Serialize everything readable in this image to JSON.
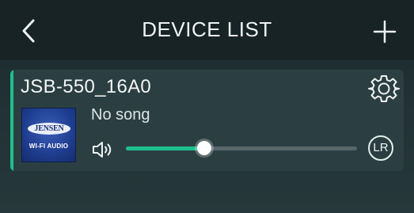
{
  "header": {
    "title": "DEVICE LIST",
    "back_icon": "chevron-left-icon",
    "add_icon": "plus-icon"
  },
  "device": {
    "name": "JSB-550_16A0",
    "song": "No song",
    "logo": {
      "brand": "JENSEN",
      "subtitle": "WI-FI AUDIO"
    },
    "volume_fraction": 0.34,
    "channel": "LR",
    "settings_icon": "gear-icon",
    "volume_icon": "speaker-icon"
  },
  "colors": {
    "accent": "#1fbf8e",
    "card": "#2b3f42",
    "header": "#182326"
  }
}
